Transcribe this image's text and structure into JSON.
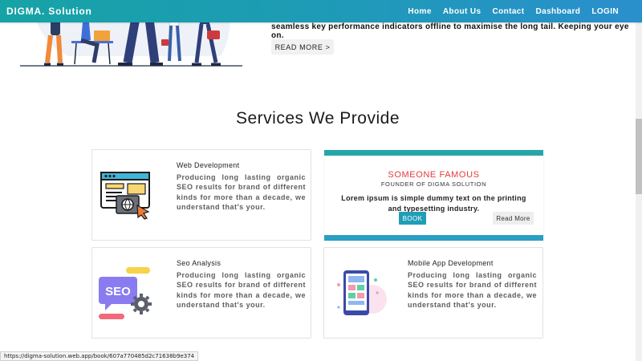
{
  "navbar": {
    "brand": "DIGMA. Solution",
    "links": [
      "Home",
      "About Us",
      "Contact",
      "Dashboard",
      "LOGIN"
    ]
  },
  "hero": {
    "text": "seamless key performance indicators offline to maximise the long tail. Keeping your eye on.",
    "read_more": "READ MORE >"
  },
  "services": {
    "heading": "Services We Provide",
    "cards": [
      {
        "title": "Web Development",
        "desc": "Producing long lasting organic SEO results for brand of different kinds for more than a decade, we understand that's your.",
        "icon": "web-development-icon"
      },
      {
        "title": "Seo Analysis",
        "desc": "Producing long lasting organic SEO results for brand of different kinds for more than a decade, we understand that's your.",
        "icon": "seo-icon",
        "icon_text": "SEO"
      },
      {
        "title": "Mobile App Development",
        "desc": "Producing long lasting organic SEO results for brand of different kinds for more than a decade, we understand that's your.",
        "icon": "mobile-app-icon"
      }
    ]
  },
  "testimonial": {
    "name": "SOMEONE FAMOUS",
    "role": "FOUNDER OF DIGMA SOLUTION",
    "quote": "Lorem ipsum is simple dummy text on the printing and typesetting industry.",
    "book_label": "BOOK",
    "more_label": "Read More"
  },
  "status_url": "https://digma-solution.web.app/book/607a770485d2c71638b9e374",
  "colors": {
    "nav_gradient_start": "#16a3a6",
    "nav_gradient_end": "#2a8fcd",
    "famous_red": "#e83a3a",
    "book_button": "#219db5"
  }
}
